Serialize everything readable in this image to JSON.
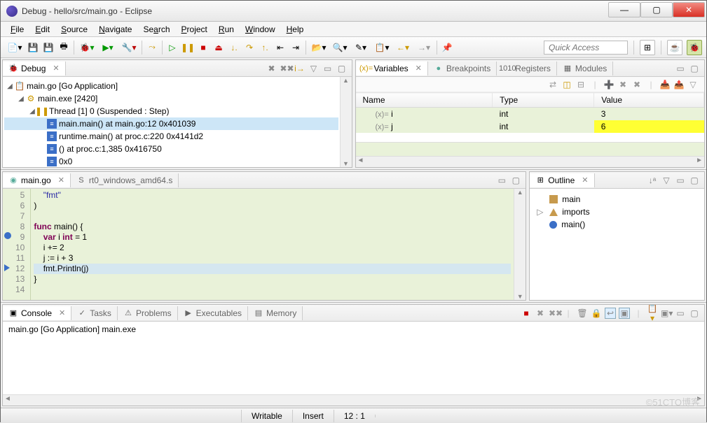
{
  "window": {
    "title": "Debug - hello/src/main.go - Eclipse"
  },
  "menus": [
    "File",
    "Edit",
    "Source",
    "Navigate",
    "Search",
    "Project",
    "Run",
    "Window",
    "Help"
  ],
  "quick_access": {
    "placeholder": "Quick Access"
  },
  "debug": {
    "view_label": "Debug",
    "nodes": {
      "launch": "main.go [Go Application]",
      "process": "main.exe [2420]",
      "thread": "Thread [1] 0 (Suspended : Step)",
      "frames": [
        "main.main() at main.go:12 0x401039",
        "runtime.main() at proc.c:220 0x4141d2",
        "() at proc.c:1,385 0x416750",
        "0x0"
      ]
    }
  },
  "variables": {
    "tabs": {
      "variables": "Variables",
      "breakpoints": "Breakpoints",
      "registers": "Registers",
      "modules": "Modules"
    },
    "columns": {
      "name": "Name",
      "type": "Type",
      "value": "Value"
    },
    "rows": [
      {
        "name": "i",
        "type": "int",
        "value": "3"
      },
      {
        "name": "j",
        "type": "int",
        "value": "6"
      }
    ]
  },
  "editor": {
    "tabs": {
      "active": "main.go",
      "inactive": "rt0_windows_amd64.s"
    },
    "lines": [
      {
        "n": 5,
        "text": "    \"fmt\""
      },
      {
        "n": 6,
        "text": ")"
      },
      {
        "n": 7,
        "text": ""
      },
      {
        "n": 8,
        "text": "func main() {"
      },
      {
        "n": 9,
        "text": "    var i int = 1"
      },
      {
        "n": 10,
        "text": "    i += 2"
      },
      {
        "n": 11,
        "text": "    j := i + 3"
      },
      {
        "n": 12,
        "text": "    fmt.Println(j)"
      },
      {
        "n": 13,
        "text": "}"
      },
      {
        "n": 14,
        "text": ""
      }
    ]
  },
  "outline": {
    "view_label": "Outline",
    "items": {
      "package": "main",
      "imports": "imports",
      "func": "main()"
    }
  },
  "console": {
    "tabs": {
      "console": "Console",
      "tasks": "Tasks",
      "problems": "Problems",
      "executables": "Executables",
      "memory": "Memory"
    },
    "header": "main.go [Go Application] main.exe"
  },
  "status": {
    "writable": "Writable",
    "insert": "Insert",
    "pos": "12 : 1"
  },
  "watermark": "©51CTO博客"
}
